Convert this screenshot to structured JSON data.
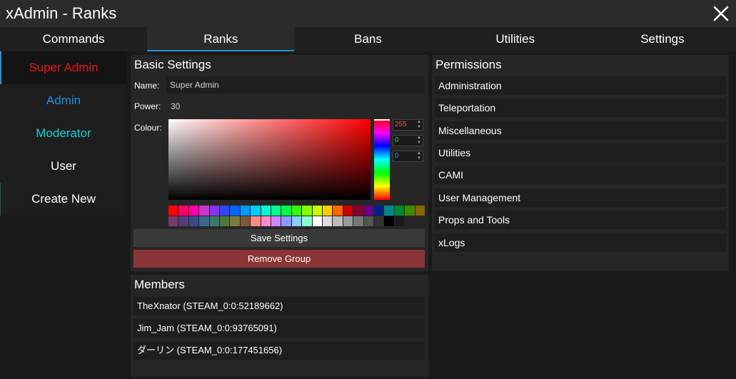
{
  "window": {
    "title": "xAdmin - Ranks"
  },
  "tabs": [
    {
      "label": "Commands"
    },
    {
      "label": "Ranks",
      "active": true
    },
    {
      "label": "Bans"
    },
    {
      "label": "Utilities"
    },
    {
      "label": "Settings"
    }
  ],
  "sidebar": {
    "items": [
      {
        "label": "Super Admin",
        "color": "#e8141e",
        "active": true
      },
      {
        "label": "Admin",
        "color": "#1e8fe6"
      },
      {
        "label": "Moderator",
        "color": "#19d2d2"
      },
      {
        "label": "User",
        "color": "#ffffff"
      },
      {
        "label": "Create New",
        "color": "#ffffff"
      }
    ]
  },
  "basic_settings": {
    "title": "Basic Settings",
    "name_label": "Name:",
    "name_value": "Super Admin",
    "power_label": "Power:",
    "power_value": "30",
    "colour_label": "Colour:",
    "rgb": {
      "r": "255",
      "g": "0",
      "b": "0"
    },
    "palette": [
      "#ff0000",
      "#ff0066",
      "#ff00aa",
      "#cc33cc",
      "#8833ff",
      "#3344ff",
      "#0066ff",
      "#0099ff",
      "#00ccff",
      "#00ffcc",
      "#00ff88",
      "#00ff44",
      "#33ff00",
      "#88ff00",
      "#ccff00",
      "#ffcc00",
      "#ff6600",
      "#cc0000",
      "#880033",
      "#660088",
      "#002288",
      "#008888",
      "#008833",
      "#448800",
      "#886600",
      "#7a3a6a",
      "#5a3a7a",
      "#3a4a8a",
      "#3a6a8a",
      "#3a7a6a",
      "#4a7a3a",
      "#7a7a3a",
      "#7a5a3a",
      "#ff8888",
      "#ff88cc",
      "#cc88ff",
      "#8899ff",
      "#88ccff",
      "#88ffcc",
      "#ffffff",
      "#dddddd",
      "#bbbbbb",
      "#999999",
      "#777777",
      "#555555",
      "#333333",
      "#000000",
      "#1a1a1a",
      "#262626",
      "#262626"
    ],
    "save_label": "Save Settings",
    "remove_label": "Remove Group"
  },
  "members": {
    "title": "Members",
    "rows": [
      "TheXnator (STEAM_0:0:52189662)",
      "Jim_Jam (STEAM_0:0:93765091)",
      "ダーリン (STEAM_0:0:177451656)"
    ]
  },
  "permissions": {
    "title": "Permissions",
    "rows": [
      "Administration",
      "Teleportation",
      "Miscellaneous",
      "Utilities",
      "CAMI",
      "User Management",
      "Props and Tools",
      "xLogs"
    ]
  }
}
